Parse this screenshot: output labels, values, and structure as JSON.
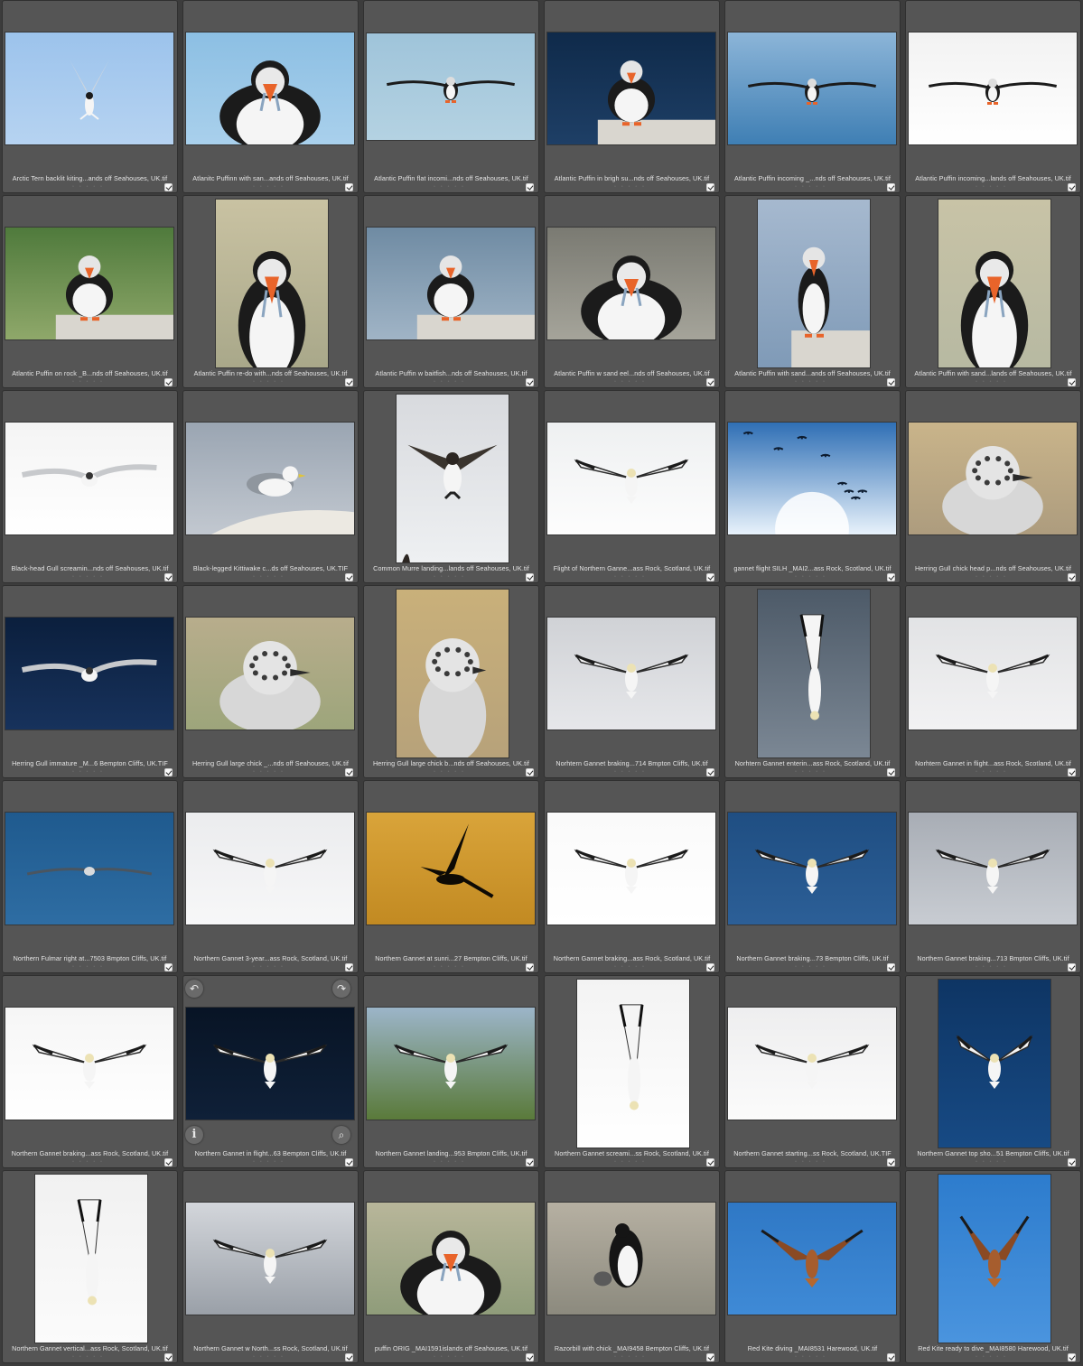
{
  "photos": [
    {
      "caption": "Arctic Tern backlit kiting...ands off Seahouses, UK.tif",
      "orient": "landscape",
      "bg": [
        "#9cc3ec",
        "#b6d3f1"
      ],
      "subject": "tern-flight"
    },
    {
      "caption": "Atlanitc Puffinn with san...ands off Seahouses, UK.tif",
      "orient": "landscape",
      "bg": [
        "#8cbfe3",
        "#a9d0ec"
      ],
      "subject": "puffin-portrait"
    },
    {
      "caption": "Atlantic Puffin flat incomi...nds off Seahouses, UK.tif",
      "orient": "landscape-wide",
      "bg": [
        "#9fc4da",
        "#b4d2e2"
      ],
      "subject": "puffin-flight"
    },
    {
      "caption": "Atlantic Puffin in brigh su...nds off Seahouses, UK.tif",
      "orient": "landscape",
      "bg": [
        "#0f2a4a",
        "#1e3f66"
      ],
      "subject": "puffin-rock"
    },
    {
      "caption": "Atlantic Puffin incoming _...nds off Seahouses, UK.tif",
      "orient": "landscape",
      "bg": [
        "#8cb5d8",
        "#3f7fb4"
      ],
      "subject": "puffin-flight"
    },
    {
      "caption": "Atlantic Puffin incoming...lands off Seahouses, UK.tif",
      "orient": "landscape",
      "bg": [
        "#f2f2f2",
        "#ffffff"
      ],
      "subject": "puffin-flight"
    },
    {
      "caption": "Atlantic Puffin on rock _B...nds off Seahouses, UK.tif",
      "orient": "landscape",
      "bg": [
        "#4f7a3c",
        "#8fa86a"
      ],
      "subject": "puffin-rock"
    },
    {
      "caption": "Atlantic Puffin re-do with...nds off Seahouses, UK.tif",
      "orient": "portrait",
      "bg": [
        "#c9c2a2",
        "#a9a88a"
      ],
      "subject": "puffin-portrait"
    },
    {
      "caption": "Atlantic Puffin w baitfish...nds off Seahouses, UK.tif",
      "orient": "landscape",
      "bg": [
        "#6f8ba3",
        "#a0b4c6"
      ],
      "subject": "puffin-rock"
    },
    {
      "caption": "Atlantic Puffin w sand eel...nds off Seahouses, UK.tif",
      "orient": "landscape",
      "bg": [
        "#7a7a72",
        "#a5a49a"
      ],
      "subject": "puffin-portrait"
    },
    {
      "caption": "Atlantic Puffin with sand...ands off Seahouses, UK.tif",
      "orient": "portrait",
      "bg": [
        "#a6b9cf",
        "#7f9ab7"
      ],
      "subject": "puffin-rock"
    },
    {
      "caption": "Atlantic Puffin with sand...lands off Seahouses, UK.tif",
      "orient": "portrait",
      "bg": [
        "#c8c3a6",
        "#b7b9a2"
      ],
      "subject": "puffin-portrait"
    },
    {
      "caption": "Black-head Gull screamin...nds off Seahouses, UK.tif",
      "orient": "landscape",
      "bg": [
        "#f4f4f4",
        "#ffffff"
      ],
      "subject": "gull-flight"
    },
    {
      "caption": "Black-legged Kittiwake c...ds off Seahouses, UK.TIF",
      "orient": "landscape",
      "bg": [
        "#9aa5b2",
        "#c2c8d0"
      ],
      "subject": "gull-rock"
    },
    {
      "caption": "Common Murre landing...lands off Seahouses, UK.tif",
      "orient": "portrait",
      "bg": [
        "#d8dade",
        "#eef0f2"
      ],
      "subject": "murre"
    },
    {
      "caption": "Flight of Northern Ganne...ass Rock, Scotland, UK.tif",
      "orient": "landscape",
      "bg": [
        "#eef0f1",
        "#fdfdfd"
      ],
      "subject": "gannet-flight"
    },
    {
      "caption": "gannet flight SILH _MAI2...ass Rock, Scotland, UK.tif",
      "orient": "landscape",
      "bg": [
        "#2f6fb5",
        "#e8f2fb"
      ],
      "subject": "silhouettes"
    },
    {
      "caption": "Herring Gull chick head p...nds off Seahouses, UK.tif",
      "orient": "landscape",
      "bg": [
        "#c9b48a",
        "#ad9c7e"
      ],
      "subject": "chick"
    },
    {
      "caption": "Herring Gull immature _M...6 Bempton Cliffs, UK.TIF",
      "orient": "landscape",
      "bg": [
        "#0b1f3d",
        "#17325c"
      ],
      "subject": "gull-flight"
    },
    {
      "caption": "Herring Gull large chick _...nds off Seahouses, UK.tif",
      "orient": "landscape",
      "bg": [
        "#b8ad8c",
        "#9da57b"
      ],
      "subject": "chick"
    },
    {
      "caption": "Herring Gull large chick b...nds off Seahouses, UK.tif",
      "orient": "portrait",
      "bg": [
        "#c9b07a",
        "#b7a27a"
      ],
      "subject": "chick"
    },
    {
      "caption": "Norhtern Gannet braking...714 Bmpton Cliffs, UK.tif",
      "orient": "landscape",
      "bg": [
        "#d0d2d6",
        "#e6e7ea"
      ],
      "subject": "gannet-flight"
    },
    {
      "caption": "Norhtern Gannet enterin...ass Rock, Scotland, UK.tif",
      "orient": "portrait",
      "bg": [
        "#4d5a68",
        "#7b8794"
      ],
      "subject": "gannet-dive"
    },
    {
      "caption": "Norhtern Gannet in flight...ass Rock, Scotland, UK.tif",
      "orient": "landscape",
      "bg": [
        "#e2e3e5",
        "#f2f2f3"
      ],
      "subject": "gannet-flight"
    },
    {
      "caption": "Northern Fulmar right at...7503 Bmpton Cliffs, UK.tif",
      "orient": "landscape",
      "bg": [
        "#1f5a8e",
        "#2e6da3"
      ],
      "subject": "fulmar"
    },
    {
      "caption": "Northern Gannet 3-year...ass Rock, Scotland, UK.tif",
      "orient": "landscape",
      "bg": [
        "#ebecee",
        "#f7f7f8"
      ],
      "subject": "gannet-flight"
    },
    {
      "caption": "Northern Gannet at sunri...27 Bempton Cliffs, UK.tif",
      "orient": "landscape",
      "bg": [
        "#d9a43a",
        "#c28a22"
      ],
      "subject": "silhouette-big"
    },
    {
      "caption": "Northern Gannet braking...ass Rock, Scotland, UK.tif",
      "orient": "landscape",
      "bg": [
        "#fafafa",
        "#ffffff"
      ],
      "subject": "gannet-flight"
    },
    {
      "caption": "Northern Gannet braking...73 Bempton Cliffs, UK.tif",
      "orient": "landscape",
      "bg": [
        "#1f4e82",
        "#2c5f97"
      ],
      "subject": "gannet-flight"
    },
    {
      "caption": "Northern Gannet braking...713 Bmpton Cliffs, UK.tif",
      "orient": "landscape",
      "bg": [
        "#a8adb5",
        "#c8ccd2"
      ],
      "subject": "gannet-flight"
    },
    {
      "caption": "Northern Gannet braking...ass Rock, Scotland, UK.tif",
      "orient": "landscape",
      "bg": [
        "#f6f6f6",
        "#ffffff"
      ],
      "subject": "gannet-flight"
    },
    {
      "caption": "Northern Gannet in flight...63 Bempton Cliffs, UK.tif",
      "orient": "landscape-hover",
      "bg": [
        "#081425",
        "#0f2038"
      ],
      "subject": "gannet-flight"
    },
    {
      "caption": "Northern Gannet landing...953 Bmpton Cliffs, UK.tif",
      "orient": "landscape",
      "bg": [
        "#9cb5c9",
        "#5a7a3a"
      ],
      "subject": "gannet-flight"
    },
    {
      "caption": "Northern Gannet screami...ss Rock, Scotland, UK.tif",
      "orient": "portrait",
      "bg": [
        "#f3f3f3",
        "#ffffff"
      ],
      "subject": "gannet-dive"
    },
    {
      "caption": "Northern Gannet starting...ss Rock, Scotland, UK.TIF",
      "orient": "landscape",
      "bg": [
        "#eeeeef",
        "#fbfbfb"
      ],
      "subject": "gannet-flight"
    },
    {
      "caption": "Northern Gannet top sho...51 Bempton Cliffs, UK.tif",
      "orient": "portrait",
      "bg": [
        "#0e3564",
        "#174a84"
      ],
      "subject": "gannet-flight"
    },
    {
      "caption": "Northern Gannet vertical...ass Rock, Scotland, UK.tif",
      "orient": "portrait",
      "bg": [
        "#f1f1f1",
        "#fbfbfb"
      ],
      "subject": "gannet-dive"
    },
    {
      "caption": "Northern Gannet w North...ss Rock, Scotland, UK.tif",
      "orient": "landscape",
      "bg": [
        "#d3d6db",
        "#9aa0a8"
      ],
      "subject": "gannet-flight"
    },
    {
      "caption": "puffin ORIG _MAI1591islands off Seahouses, UK.tif",
      "orient": "landscape",
      "bg": [
        "#b8b69a",
        "#8f9c7a"
      ],
      "subject": "puffin-portrait"
    },
    {
      "caption": "Razorbill with chick _MAI9458 Bempton Cliffs, UK.tif",
      "orient": "landscape",
      "bg": [
        "#b6b0a2",
        "#8c8a7e"
      ],
      "subject": "razorbill"
    },
    {
      "caption": "Red Kite diving _MAI8531 Harewood, UK.tif",
      "orient": "landscape",
      "bg": [
        "#2f78c5",
        "#3f8ad6"
      ],
      "subject": "kite"
    },
    {
      "caption": "Red Kite ready to dive _MAI8580 Harewood, UK.tif",
      "orient": "portrait",
      "bg": [
        "#2d7ccd",
        "#4a94de"
      ],
      "subject": "kite"
    }
  ],
  "hover_icons": {
    "rotate_left": "rotate-left-icon",
    "rotate_right": "rotate-right-icon",
    "info": "info-icon",
    "zoom": "magnifier-icon"
  },
  "hover_glyphs": {
    "rotate_left": "↶",
    "rotate_right": "↷",
    "info": "i",
    "zoom": "⌕"
  }
}
